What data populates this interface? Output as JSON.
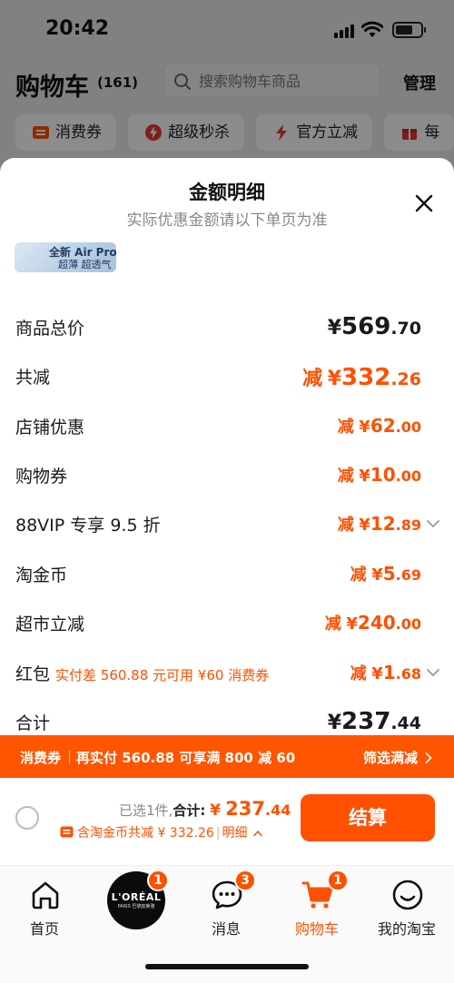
{
  "status_bar": {
    "time": "20:42"
  },
  "header": {
    "title": "购物车",
    "count": "(161)",
    "search_placeholder": "搜索购物车商品",
    "manage_label": "管理"
  },
  "chips": [
    {
      "label": "消费券",
      "icon": "coupon-icon",
      "color": "#ff5000"
    },
    {
      "label": "超级秒杀",
      "icon": "flash-sale-icon",
      "color": "#e53935"
    },
    {
      "label": "官方立减",
      "icon": "lightning-icon",
      "color": "#e53935"
    },
    {
      "label": "每",
      "icon": "gift-icon",
      "color": "#e53935"
    }
  ],
  "sheet": {
    "title": "金额明细",
    "subtitle": "实际优惠金额请以下单页为准",
    "banner": {
      "line1": "全新 Air Pro",
      "line2": "超薄 超透气"
    },
    "rows": [
      {
        "label": "商品总价",
        "prefix": "",
        "currency": "¥",
        "int": "569",
        "dec": ".70"
      },
      {
        "label": "共减",
        "prefix": "减",
        "currency": "¥",
        "int": "332",
        "dec": ".26"
      },
      {
        "label": "店铺优惠",
        "prefix": "减",
        "currency": "¥",
        "int": "62",
        "dec": ".00"
      },
      {
        "label": "购物券",
        "prefix": "减",
        "currency": "¥",
        "int": "10",
        "dec": ".00"
      },
      {
        "label": "88VIP 专享 9.5 折",
        "prefix": "减",
        "currency": "¥",
        "int": "12",
        "dec": ".89"
      },
      {
        "label": "淘金币",
        "prefix": "减",
        "currency": "¥",
        "int": "5",
        "dec": ".69"
      },
      {
        "label": "超市立减",
        "prefix": "减",
        "currency": "¥",
        "int": "240",
        "dec": ".00"
      },
      {
        "label": "红包",
        "note": "实付差 560.88 元可用 ¥60 消费券",
        "prefix": "减",
        "currency": "¥",
        "int": "1",
        "dec": ".68"
      },
      {
        "label": "合计",
        "prefix": "",
        "currency": "¥",
        "int": "237",
        "dec": ".44"
      }
    ]
  },
  "coupon_strip": {
    "tag": "消费券",
    "message": "再实付 560.88 可享满 800 减 60",
    "action": "筛选满减"
  },
  "checkout": {
    "selected": "已选1件,",
    "total_label": "合计:",
    "total_currency": "¥",
    "total_int": "237",
    "total_dec": ".44",
    "discount_text": "含淘金币共减 ¥ 332.26",
    "detail_label": "明细",
    "pay_label": "结算"
  },
  "tabbar": [
    {
      "label": "首页",
      "icon": "home-icon"
    },
    {
      "label": "",
      "icon": "loreal-logo",
      "logo_text": "L'ORÉAL",
      "logo_sub": "PARIS 巴黎欧莱雅",
      "badge": "1"
    },
    {
      "label": "消息",
      "icon": "message-icon",
      "badge": "3"
    },
    {
      "label": "购物车",
      "icon": "cart-icon",
      "badge": "1",
      "active": true
    },
    {
      "label": "我的淘宝",
      "icon": "smile-icon"
    }
  ],
  "colors": {
    "accent": "#ff5000",
    "text": "#1a1a1a",
    "muted": "#888888"
  }
}
